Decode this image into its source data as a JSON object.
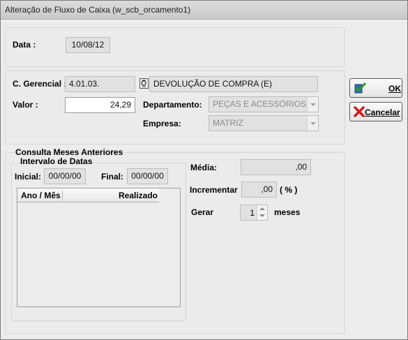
{
  "window": {
    "title": "Alteração de Fluxo de Caixa (w_scb_orcamento1)"
  },
  "data": {
    "label": "Data :",
    "value": "10/08/12"
  },
  "gerencial": {
    "label": "C. Gerencial :",
    "code": "4.01.03.",
    "description": "DEVOLUÇÃO DE COMPRA (E)"
  },
  "valor": {
    "label": "Valor :",
    "value": "24,29"
  },
  "departamento": {
    "label": "Departamento:",
    "value": "PEÇAS E ACESSÓRIOS"
  },
  "empresa": {
    "label": "Empresa:",
    "value": "MATRIZ"
  },
  "buttons": {
    "ok": "OK",
    "cancel": "Cancelar"
  },
  "consulta": {
    "title": "Consulta Meses Anteriores",
    "subtitle": "Intervalo de Datas",
    "inicial_label": "Inicial:",
    "inicial_value": "00/00/00",
    "final_label": "Final:",
    "final_value": "00/00/00",
    "columns": [
      "Ano / Mês",
      "Realizado"
    ]
  },
  "stats": {
    "media_label": "Média:",
    "media_value": ",00",
    "incrementar_label": "Incrementar",
    "incrementar_value": ",00",
    "percent_label": "( % )",
    "gerar_label": "Gerar",
    "gerar_value": "1",
    "meses_label": "meses"
  },
  "icons": {
    "ok": "checkmark-with-bookmark-icon",
    "cancel": "red-x-icon",
    "lookup": "lookup-icon"
  }
}
